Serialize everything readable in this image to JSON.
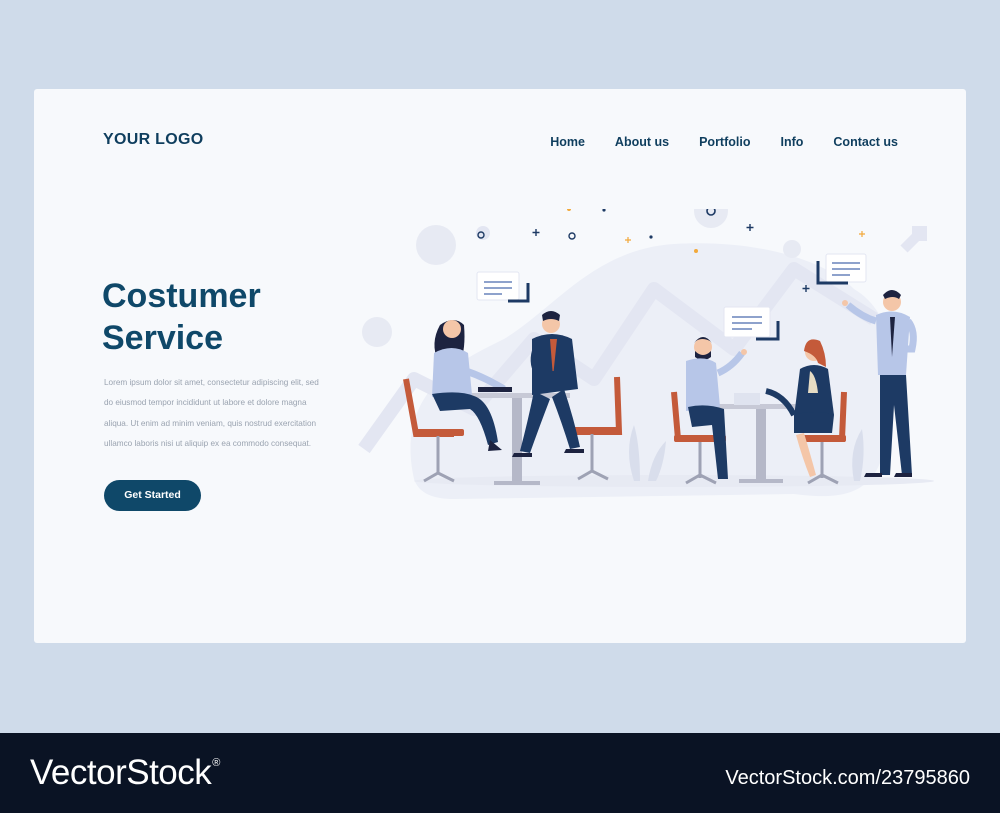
{
  "header": {
    "logo": "YOUR LOGO",
    "nav": [
      "Home",
      "About us",
      "Portfolio",
      "Info",
      "Contact us"
    ]
  },
  "hero": {
    "title_line1": "Costumer",
    "title_line2": "Service",
    "body": "Lorem ipsum dolor sit amet, consectetur adipiscing elit, sed do eiusmod tempor incididunt ut labore et dolore magna aliqua. Ut enim ad minim veniam, quis nostrud exercitation ullamco laboris nisi ut aliquip ex ea commodo consequat.",
    "cta_label": "Get Started"
  },
  "illustration": {
    "subject": "people-meeting-at-tables-icon",
    "colors": {
      "navy": "#1d3a64",
      "chair": "#c45a3a",
      "lavender": "#e3e6f2",
      "accent": "#f2a93b"
    }
  },
  "watermark": {
    "brand": "VectorStock",
    "registered": "®",
    "stock_id": "VectorStock.com/23795860"
  },
  "colors": {
    "primary": "#0f4869",
    "background": "#cfdbea",
    "card": "#f7f9fc",
    "footer": "#0a1324"
  }
}
